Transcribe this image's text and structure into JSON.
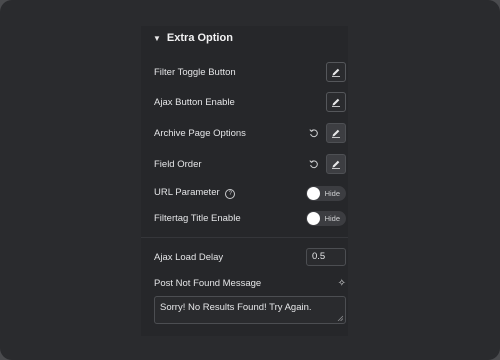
{
  "section": {
    "title": "Extra Option",
    "collapse_icon": "caret-down-icon"
  },
  "rows": {
    "filter_toggle": {
      "label": "Filter Toggle Button"
    },
    "ajax_button": {
      "label": "Ajax Button Enable"
    },
    "archive_page": {
      "label": "Archive Page Options"
    },
    "field_order": {
      "label": "Field Order"
    },
    "url_parameter": {
      "label": "URL Parameter",
      "toggle_text": "Hide",
      "help_icon": "?"
    },
    "filtertag_title": {
      "label": "Filtertag Title Enable",
      "toggle_text": "Hide"
    },
    "ajax_load_delay": {
      "label": "Ajax Load Delay",
      "value": "0.5"
    },
    "post_not_found": {
      "label": "Post Not Found Message",
      "value": "Sorry! No Results Found! Try Again.",
      "ai_icon": "sparkle-icon"
    }
  },
  "colors": {
    "background": "#2a2b2e",
    "panel": "#26272a",
    "toggle_off": "#3c3d41",
    "text": "#e6e7e9"
  }
}
